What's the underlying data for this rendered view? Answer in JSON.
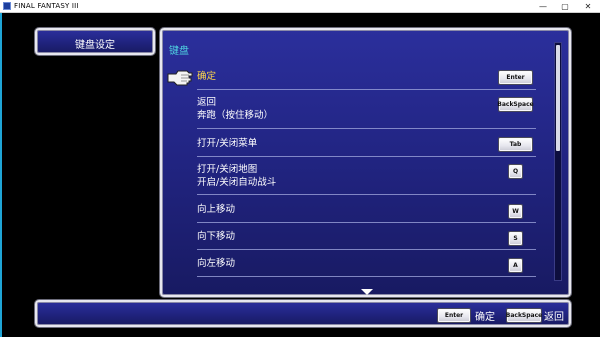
{
  "window": {
    "title": "FINAL FANTASY III",
    "controls": [
      "—",
      "▢",
      "✕"
    ]
  },
  "header": {
    "title": "键盘设定"
  },
  "section": {
    "title": "键盘"
  },
  "rows": [
    {
      "lines": [
        "确定"
      ],
      "key": "Enter",
      "selected": true
    },
    {
      "lines": [
        "返回",
        "奔跑（按住移动）"
      ],
      "key": "BackSpace",
      "selected": false
    },
    {
      "lines": [
        "打开/关闭菜单"
      ],
      "key": "Tab",
      "selected": false
    },
    {
      "lines": [
        "打开/关闭地图",
        "开启/关闭自动战斗"
      ],
      "key": "Q",
      "selected": false
    },
    {
      "lines": [
        "向上移动"
      ],
      "key": "W",
      "selected": false
    },
    {
      "lines": [
        "向下移动"
      ],
      "key": "S",
      "selected": false
    },
    {
      "lines": [
        "向左移动"
      ],
      "key": "A",
      "selected": false
    }
  ],
  "footer": {
    "confirm": {
      "key": "Enter",
      "label": "确定"
    },
    "back": {
      "key": "BackSpace",
      "label": "返回"
    }
  },
  "colors": {
    "selected_text": "#ffd84a",
    "section_title": "#4fd1e0",
    "panel_blue": "#222584"
  }
}
